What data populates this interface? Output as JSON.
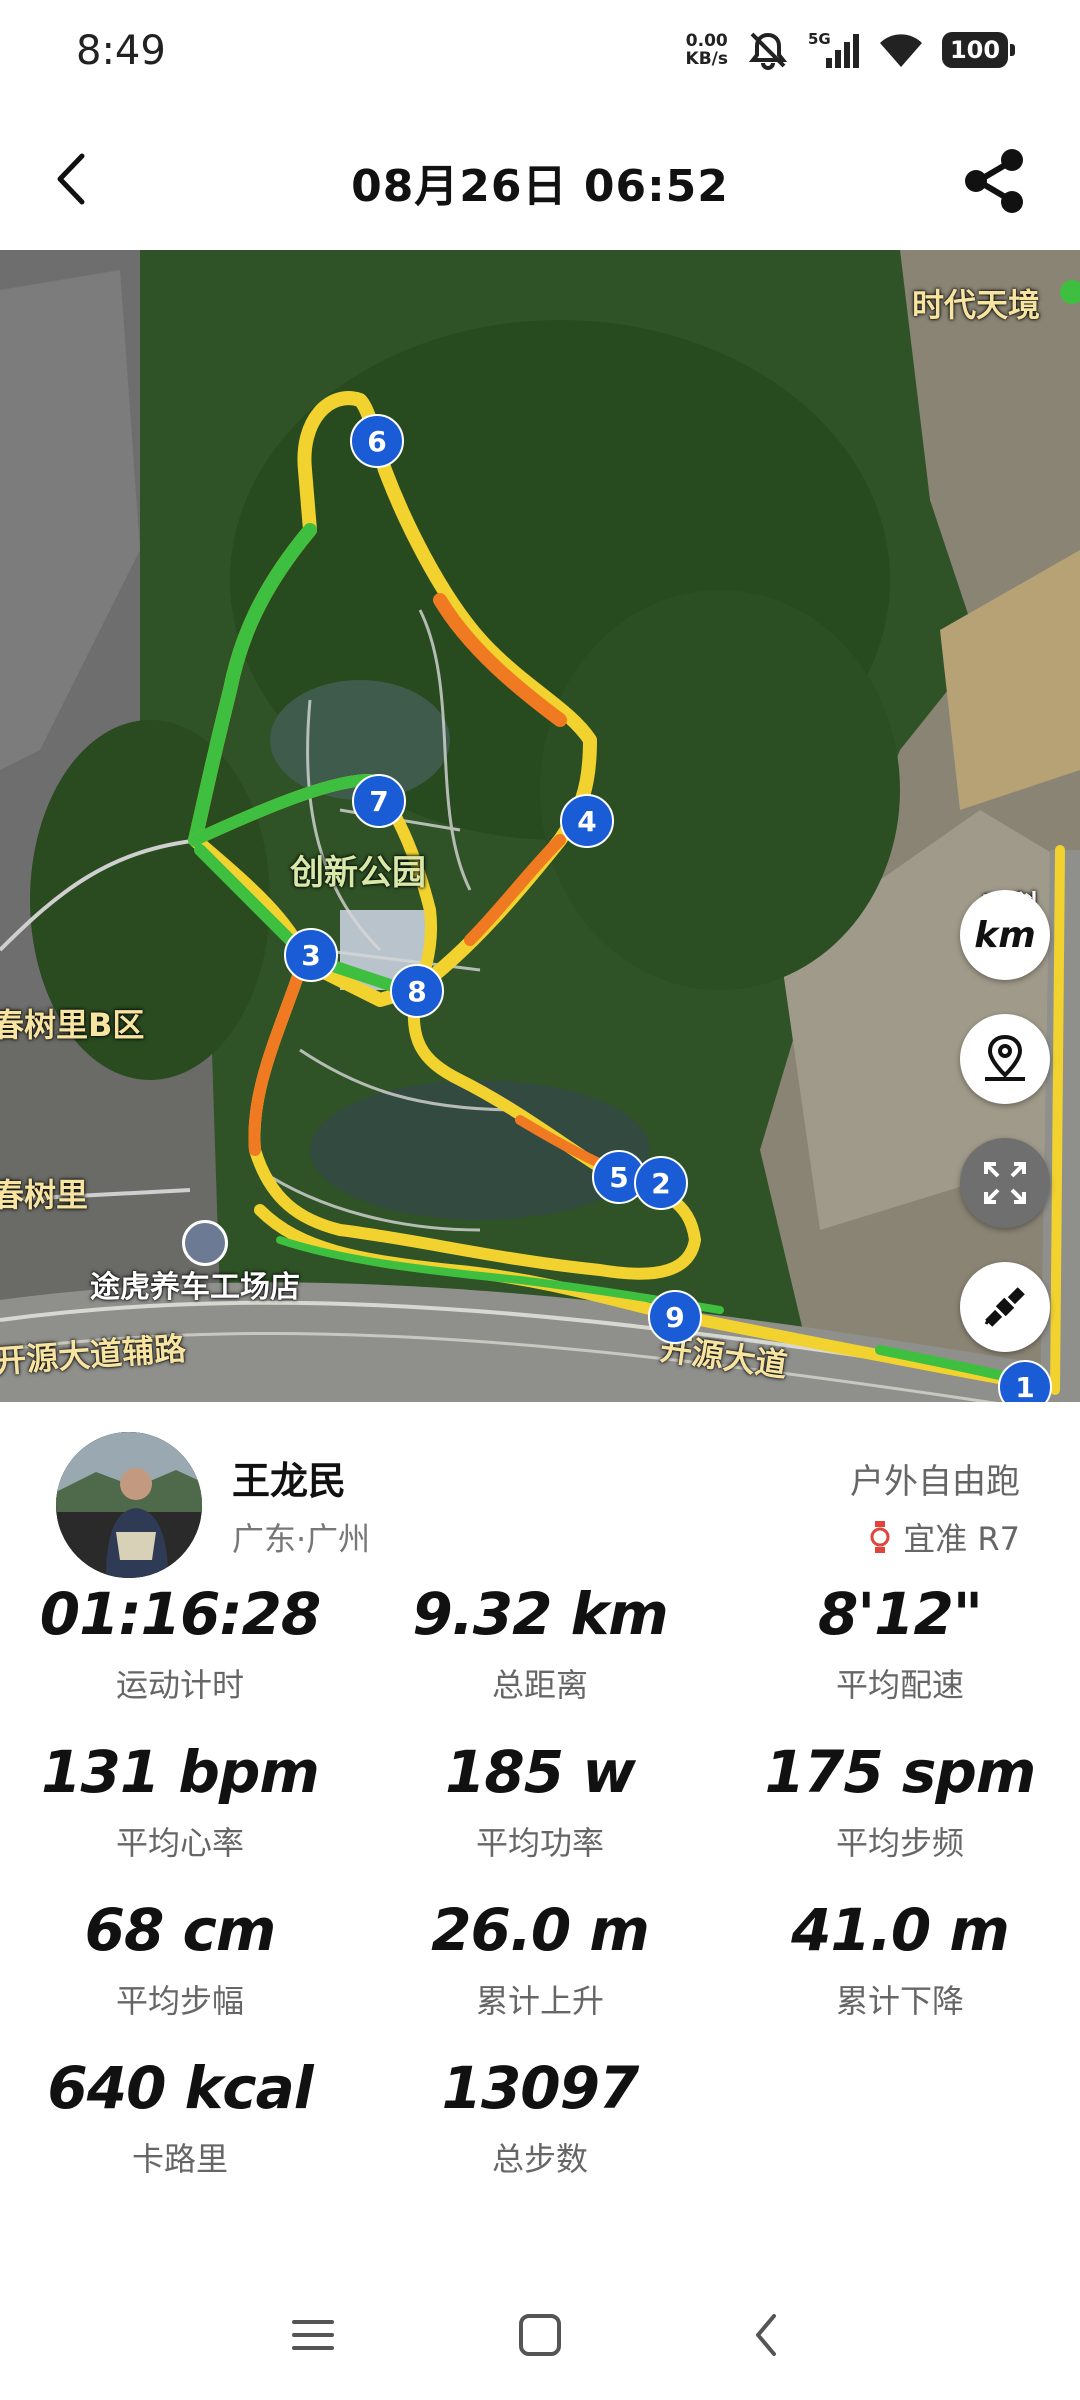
{
  "status_bar": {
    "time": "8:49",
    "net_speed_value": "0.00",
    "net_speed_unit": "KB/s",
    "network_type": "5G",
    "battery": "100"
  },
  "header": {
    "title": "08月26日 06:52"
  },
  "map": {
    "labels": {
      "park": "创新公园",
      "building_top_right": "时代天境",
      "residential_b": "春树里B区",
      "residential": "春树里",
      "poi_shop": "途虎养车工场店",
      "road_aux": "开源大道辅路",
      "road_main": "开源大道",
      "partial_right": "口科"
    },
    "markers": [
      "1",
      "2",
      "3",
      "4",
      "5",
      "6",
      "7",
      "8",
      "9"
    ],
    "unit_button": "km"
  },
  "profile": {
    "name": "王龙民",
    "location": "广东·广州",
    "activity_type": "户外自由跑",
    "device": "宜准 R7"
  },
  "stats": [
    {
      "value": "01:16:28",
      "label": "运动计时"
    },
    {
      "value": "9.32 km",
      "label": "总距离"
    },
    {
      "value": "8'12\"",
      "label": "平均配速"
    },
    {
      "value": "131 bpm",
      "label": "平均心率"
    },
    {
      "value": "185 w",
      "label": "平均功率"
    },
    {
      "value": "175 spm",
      "label": "平均步频"
    },
    {
      "value": "68 cm",
      "label": "平均步幅"
    },
    {
      "value": "26.0 m",
      "label": "累计上升"
    },
    {
      "value": "41.0 m",
      "label": "累计下降"
    },
    {
      "value": "640 kcal",
      "label": "卡路里"
    },
    {
      "value": "13097",
      "label": "总步数"
    }
  ],
  "colors": {
    "route_green": "#3fbf3f",
    "route_yellow": "#f2d22e",
    "route_orange": "#ef7a22",
    "marker_blue": "#1a5bd6",
    "device_red": "#e0443a"
  }
}
